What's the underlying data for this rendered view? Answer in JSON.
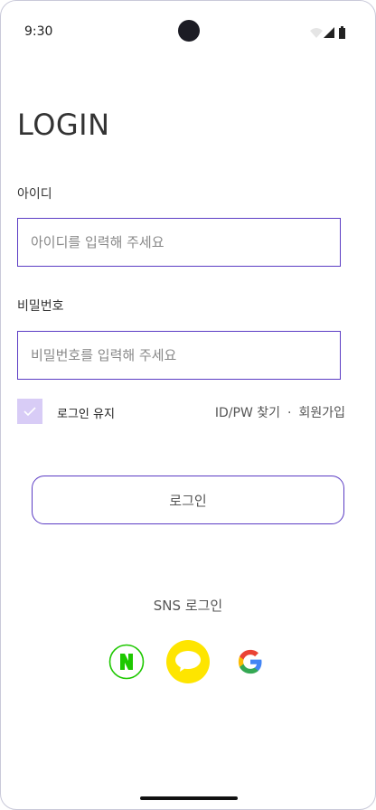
{
  "status": {
    "time": "9:30"
  },
  "header": {
    "title": "LOGIN"
  },
  "form": {
    "id_label": "아이디",
    "id_placeholder": "아이디를 입력해 주세요",
    "pw_label": "비밀번호",
    "pw_placeholder": "비밀번호를 입력해 주세요",
    "remember_label": "로그인 유지",
    "remember_checked": true,
    "find_label": "ID/PW 찾기",
    "separator": "·",
    "signup_label": "회원가입",
    "login_button": "로그인"
  },
  "sns": {
    "label": "SNS 로그인",
    "providers": [
      "naver-icon",
      "kakao-icon",
      "google-icon"
    ]
  },
  "colors": {
    "accent": "#5b3cc4",
    "checkbox_fill": "#d8ccf6",
    "naver": "#1ec800",
    "kakao": "#fee500"
  }
}
